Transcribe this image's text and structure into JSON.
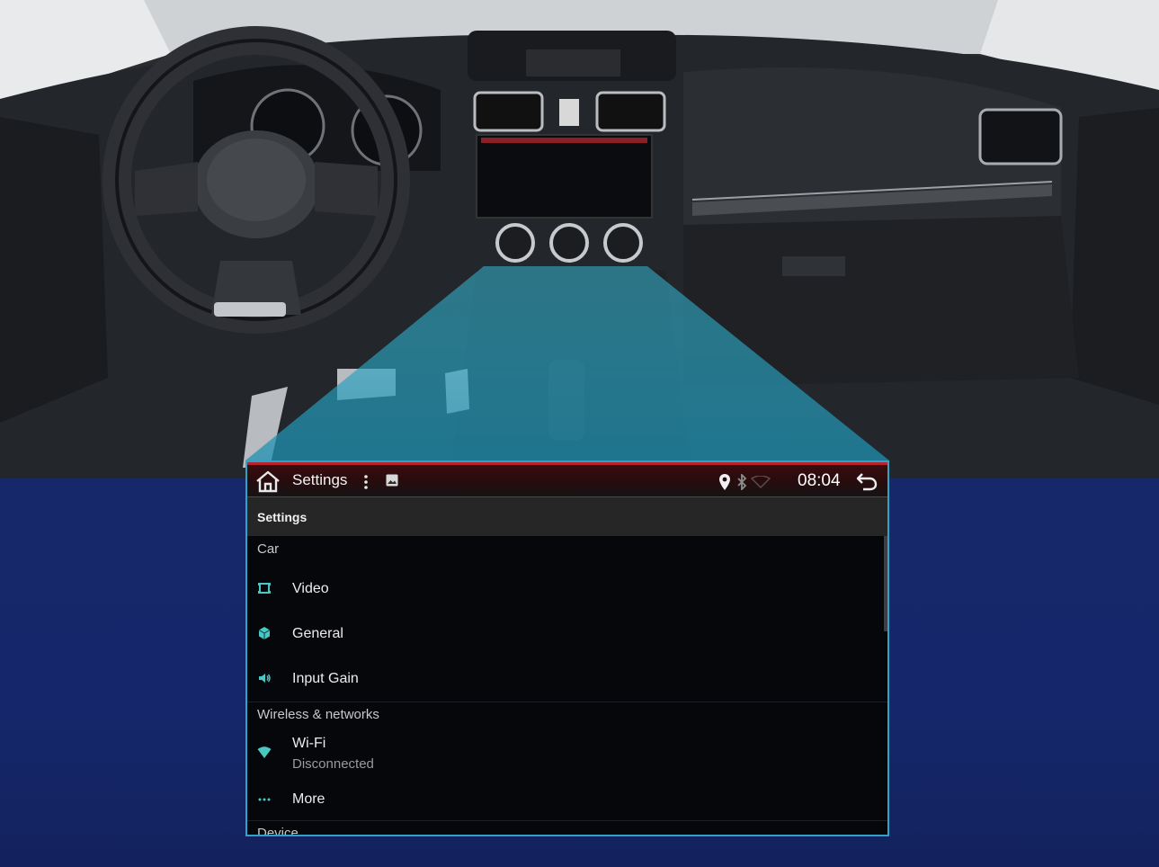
{
  "colors": {
    "accent": "#2fa3c7",
    "statusbar_red": "#b8232a",
    "icon_teal": "#49c7c2",
    "background_navy": "#142565"
  },
  "status_bar": {
    "title": "Settings",
    "time": "08:04",
    "icons": [
      "home-icon",
      "overflow-menu-icon",
      "image-icon",
      "location-icon",
      "bluetooth-icon",
      "signal-icon",
      "back-icon"
    ]
  },
  "app_bar": {
    "title": "Settings"
  },
  "settings": {
    "sections": [
      {
        "header": "Car",
        "items": [
          {
            "icon": "video-icon",
            "label": "Video"
          },
          {
            "icon": "cube-icon",
            "label": "General"
          },
          {
            "icon": "volume-icon",
            "label": "Input Gain"
          }
        ]
      },
      {
        "header": "Wireless & networks",
        "items": [
          {
            "icon": "wifi-icon",
            "label": "Wi-Fi",
            "summary": "Disconnected"
          },
          {
            "icon": "more-icon",
            "label": "More"
          }
        ]
      },
      {
        "header": "Device",
        "items": []
      }
    ]
  }
}
